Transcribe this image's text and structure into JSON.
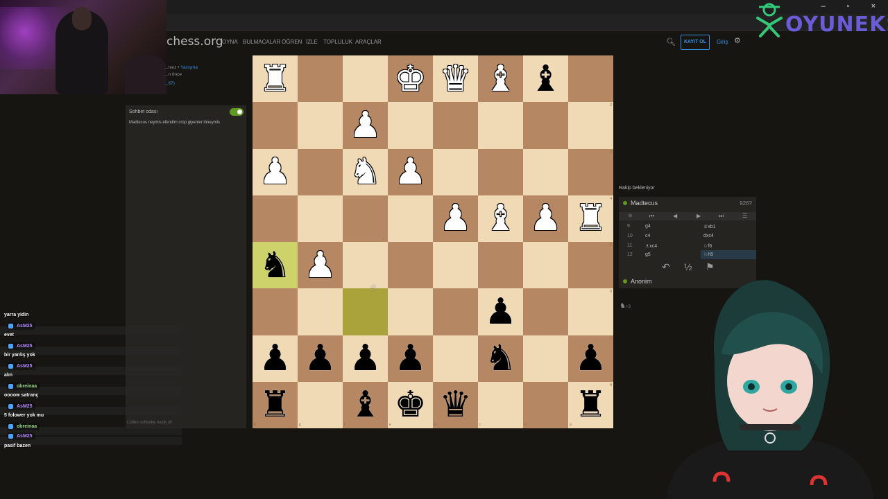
{
  "window": {
    "controls": "– ▫ ×"
  },
  "logo": {
    "text": "OYUNEKS"
  },
  "site": {
    "name": "chess.org",
    "nav": [
      "OYNA",
      "BULMACALAR",
      "ÖĞREN",
      "İZLE",
      "TOPLULUK",
      "ARAÇLAR"
    ],
    "signup_label": "KAYIT OL",
    "login_label": "Giriş"
  },
  "game_info": {
    "line1_prefix": "…nsız • ",
    "line1_link": "Yazışma",
    "line2": "…n önce",
    "line3": "…67)"
  },
  "chat": {
    "title": "Sohbet odası",
    "message": "Madtecus  neymis efendim crop giyenler ibneymis",
    "input_hint": "Lütfen sohbette nazik ol!"
  },
  "board": {
    "squares": [
      [
        "wR",
        "",
        "",
        "wK",
        "wQ",
        "wB",
        "bB",
        ""
      ],
      [
        "",
        "",
        "wP",
        "",
        "",
        "",
        "",
        ""
      ],
      [
        "wP",
        "",
        "wN",
        "wP",
        "",
        "",
        "",
        ""
      ],
      [
        "",
        "",
        "",
        "",
        "wP",
        "wB",
        "wP",
        "wR"
      ],
      [
        "bN",
        "wP",
        "",
        "",
        "",
        "",
        "",
        ""
      ],
      [
        "",
        "",
        "",
        "",
        "",
        "bP",
        "",
        ""
      ],
      [
        "bP",
        "bP",
        "bP",
        "bP",
        "",
        "bN",
        "",
        "bP"
      ],
      [
        "bR",
        "",
        "bB",
        "bK",
        "bQ",
        "",
        "",
        "bR"
      ]
    ],
    "highlight_squares": [
      [
        4,
        0
      ],
      [
        5,
        2
      ]
    ],
    "rank_labels": [
      "1",
      "2",
      "3",
      "4",
      "5",
      "6",
      "7",
      "8"
    ],
    "file_labels": [
      "h",
      "g",
      "f",
      "e",
      "d",
      "c",
      "b",
      "a"
    ]
  },
  "panel": {
    "waiting_text": "Rakip bekleniyor",
    "top_player": {
      "name": "Madtecus",
      "rating": "926?"
    },
    "bottom_player": {
      "name": "Anonim"
    },
    "moves": [
      {
        "num": "9",
        "white": "g4",
        "black": "♕xb1"
      },
      {
        "num": "10",
        "white": "c4",
        "black": "dxc4"
      },
      {
        "num": "11",
        "white": "♗xc4",
        "black": "♘f6"
      },
      {
        "num": "12",
        "white": "g5",
        "black": "♘h5"
      }
    ],
    "captured": "+3"
  },
  "stream_chat": [
    {
      "type": "text",
      "text": "yarra yidin"
    },
    {
      "type": "user",
      "name": "AsM25",
      "color": "purple"
    },
    {
      "type": "text",
      "text": "evet"
    },
    {
      "type": "user",
      "name": "AsM25",
      "color": "purple"
    },
    {
      "type": "text",
      "text": "bir yanlış yok"
    },
    {
      "type": "user",
      "name": "AsM25",
      "color": "purple"
    },
    {
      "type": "text",
      "text": "alın"
    },
    {
      "type": "user",
      "name": "obreinaa",
      "color": "green"
    },
    {
      "type": "text",
      "text": "oooow satranç"
    },
    {
      "type": "user",
      "name": "AsM25",
      "color": "purple"
    },
    {
      "type": "text",
      "text": "5 folower yok mu"
    },
    {
      "type": "user",
      "name": "obreinaa",
      "color": "green"
    },
    {
      "type": "user",
      "name": "AsM25",
      "color": "purple"
    },
    {
      "type": "text",
      "text": "pasif bazen"
    }
  ]
}
